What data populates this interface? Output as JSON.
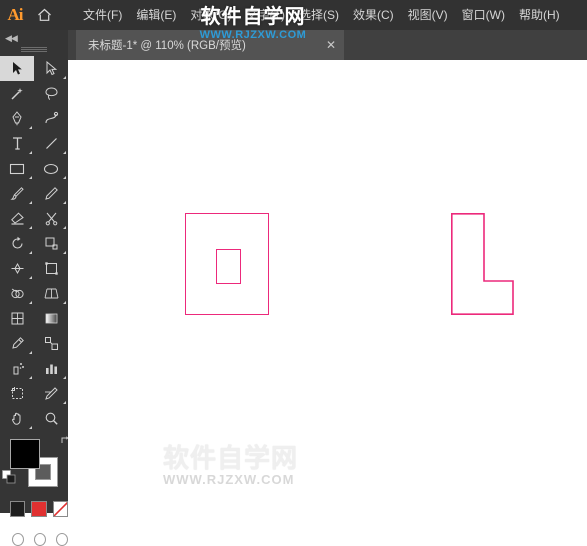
{
  "app": {
    "name": "Adobe Illustrator",
    "logo_text": "Ai",
    "home_icon": "home-icon"
  },
  "menubar": {
    "items": [
      {
        "label": "文件(F)",
        "name": "menu-file"
      },
      {
        "label": "编辑(E)",
        "name": "menu-edit"
      },
      {
        "label": "对象(O)",
        "name": "menu-object"
      },
      {
        "label": "文字(T)",
        "name": "menu-type"
      },
      {
        "label": "选择(S)",
        "name": "menu-select"
      },
      {
        "label": "效果(C)",
        "name": "menu-effect"
      },
      {
        "label": "视图(V)",
        "name": "menu-view"
      },
      {
        "label": "窗口(W)",
        "name": "menu-window"
      },
      {
        "label": "帮助(H)",
        "name": "menu-help"
      }
    ]
  },
  "watermark_top": {
    "main": "软件自学网",
    "sub": "WWW.RJZXW.COM"
  },
  "watermark_bottom": {
    "main": "软件自学网",
    "sub": "WWW.RJZXW.COM"
  },
  "tabbar": {
    "tab_title": "未标题-1* @ 110% (RGB/预览)",
    "close_label": "✕"
  },
  "toolbar": {
    "collapse_label": "◀◀",
    "tools": [
      {
        "name": "selection-tool",
        "icon": "arrow-solid-icon",
        "selected": true,
        "has_flyout": false
      },
      {
        "name": "direct-selection-tool",
        "icon": "arrow-outline-icon",
        "selected": false,
        "has_flyout": true
      },
      {
        "name": "magic-wand-tool",
        "icon": "magic-wand-icon",
        "selected": false,
        "has_flyout": false
      },
      {
        "name": "lasso-tool",
        "icon": "lasso-icon",
        "selected": false,
        "has_flyout": false
      },
      {
        "name": "pen-tool",
        "icon": "pen-icon",
        "selected": false,
        "has_flyout": true
      },
      {
        "name": "curvature-tool",
        "icon": "curvature-icon",
        "selected": false,
        "has_flyout": false
      },
      {
        "name": "type-tool",
        "icon": "type-t-icon",
        "selected": false,
        "has_flyout": true
      },
      {
        "name": "line-segment-tool",
        "icon": "line-icon",
        "selected": false,
        "has_flyout": true
      },
      {
        "name": "rectangle-tool",
        "icon": "rectangle-icon",
        "selected": false,
        "has_flyout": true
      },
      {
        "name": "ellipse-tool",
        "icon": "ellipse-icon",
        "selected": false,
        "has_flyout": true
      },
      {
        "name": "paintbrush-tool",
        "icon": "paintbrush-icon",
        "selected": false,
        "has_flyout": true
      },
      {
        "name": "shaper-tool",
        "icon": "shaper-pencil-icon",
        "selected": false,
        "has_flyout": true
      },
      {
        "name": "eraser-tool",
        "icon": "eraser-icon",
        "selected": false,
        "has_flyout": true
      },
      {
        "name": "rotate-tool",
        "icon": "rotate-icon",
        "selected": false,
        "has_flyout": true
      },
      {
        "name": "scale-tool",
        "icon": "scale-icon",
        "selected": false,
        "has_flyout": true
      },
      {
        "name": "width-tool",
        "icon": "width-icon",
        "selected": false,
        "has_flyout": true
      },
      {
        "name": "free-transform-tool",
        "icon": "free-transform-icon",
        "selected": false,
        "has_flyout": false
      },
      {
        "name": "shape-builder-tool",
        "icon": "shape-builder-icon",
        "selected": false,
        "has_flyout": true
      },
      {
        "name": "perspective-grid-tool",
        "icon": "perspective-grid-icon",
        "selected": false,
        "has_flyout": true
      },
      {
        "name": "mesh-tool",
        "icon": "mesh-icon",
        "selected": false,
        "has_flyout": false
      },
      {
        "name": "gradient-tool",
        "icon": "gradient-icon",
        "selected": false,
        "has_flyout": false
      },
      {
        "name": "eyedropper-tool",
        "icon": "eyedropper-icon",
        "selected": false,
        "has_flyout": true
      },
      {
        "name": "blend-tool",
        "icon": "blend-icon",
        "selected": false,
        "has_flyout": false
      },
      {
        "name": "symbol-sprayer-tool",
        "icon": "symbol-sprayer-icon",
        "selected": false,
        "has_flyout": true
      },
      {
        "name": "column-graph-tool",
        "icon": "bar-chart-icon",
        "selected": false,
        "has_flyout": true
      },
      {
        "name": "artboard-tool",
        "icon": "artboard-icon",
        "selected": false,
        "has_flyout": false
      },
      {
        "name": "slice-tool",
        "icon": "slice-icon",
        "selected": false,
        "has_flyout": true
      },
      {
        "name": "hand-tool",
        "icon": "hand-icon",
        "selected": false,
        "has_flyout": true
      },
      {
        "name": "zoom-tool",
        "icon": "magnifier-icon",
        "selected": false,
        "has_flyout": false
      }
    ],
    "colors": {
      "fill": "#000000",
      "stroke": "#ffffff",
      "swap_icon": "swap-arrows-icon",
      "default_icon": "default-colors-icon",
      "mode_swatches": [
        {
          "name": "color-mode-button",
          "color": "#1e1e1e"
        },
        {
          "name": "gradient-mode-button",
          "color": "#e03131"
        },
        {
          "name": "none-mode-button",
          "color": "#ffffff"
        }
      ],
      "bottom_buttons": [
        {
          "name": "change-screen-mode-button",
          "icon": "screen-mode-icon"
        },
        {
          "name": "drawing-mode-normal-button",
          "icon": "draw-normal-icon"
        },
        {
          "name": "edit-toolbar-button",
          "icon": "edit-toolbar-icon"
        }
      ]
    }
  },
  "canvas": {
    "stroke_color": "#ec297b",
    "shapes": [
      {
        "name": "outer-rectangle",
        "type": "rect"
      },
      {
        "name": "inner-rectangle",
        "type": "rect"
      },
      {
        "name": "l-shape-path",
        "type": "path"
      }
    ]
  }
}
